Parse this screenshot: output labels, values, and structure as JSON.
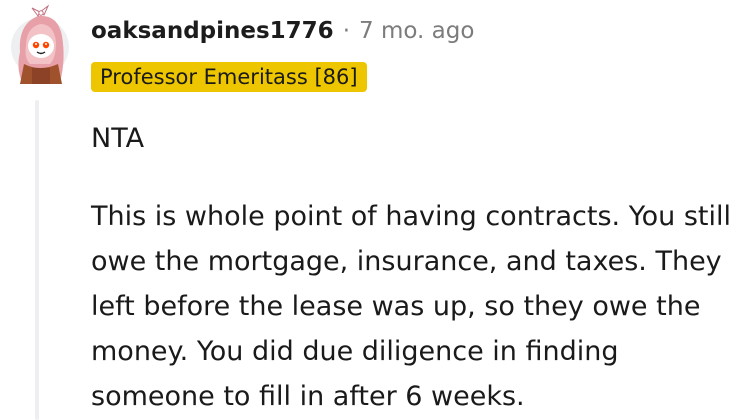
{
  "comment": {
    "username": "oaksandpines1776",
    "separator": "·",
    "timestamp": "7 mo. ago",
    "flair": "Professor Emeritass [86]",
    "paragraphs": [
      "NTA",
      "This is whole point of having contracts. You still owe the mortgage, insurance, and taxes. They left before the lease was up, so they owe the money. You did due diligence in finding someone to fill in after 6 weeks."
    ]
  },
  "colors": {
    "flair_background": "#edc600",
    "thread_line": "#edeff1",
    "meta_text": "#7c7c7c",
    "body_text": "#1a1a1b"
  },
  "icons": {
    "avatar": "snoo-avatar-with-pink-hood-icon"
  }
}
